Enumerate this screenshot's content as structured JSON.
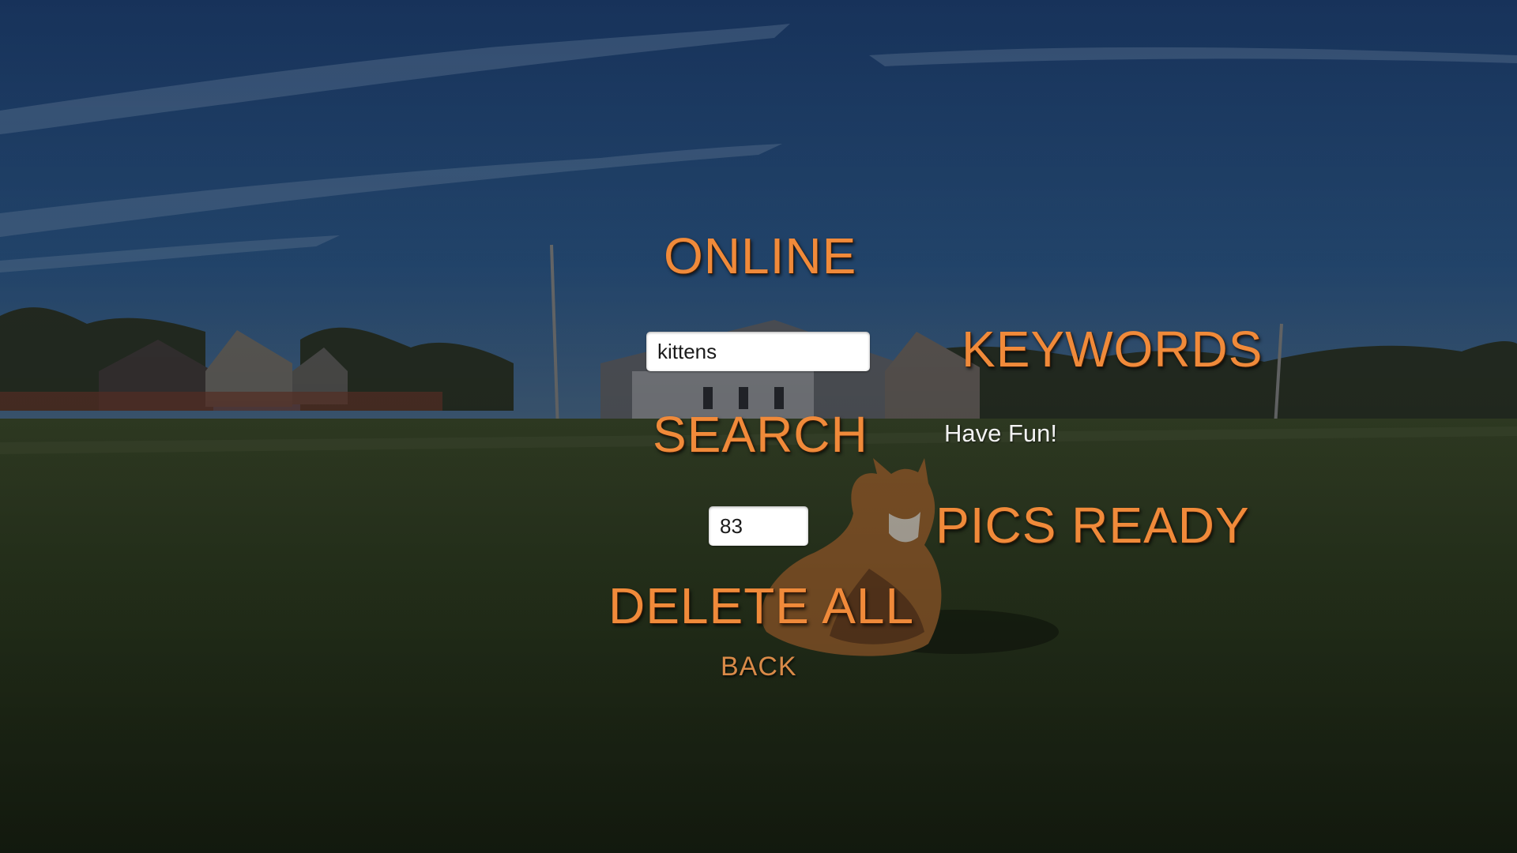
{
  "menu": {
    "title": "ONLINE",
    "keywords_label": "KEYWORDS",
    "search_button": "SEARCH",
    "pics_ready_label": "PICS READY",
    "delete_all_button": "DELETE ALL",
    "back_button": "BACK"
  },
  "search": {
    "keyword_value": "kittens",
    "pics_count_value": "83"
  },
  "status": {
    "message": "Have Fun!"
  },
  "colors": {
    "accent": "#f08a3a",
    "sky": "#1f3f6e",
    "grass": "#2c3a1e"
  },
  "background": {
    "scene": "painted-field-with-corgi"
  }
}
